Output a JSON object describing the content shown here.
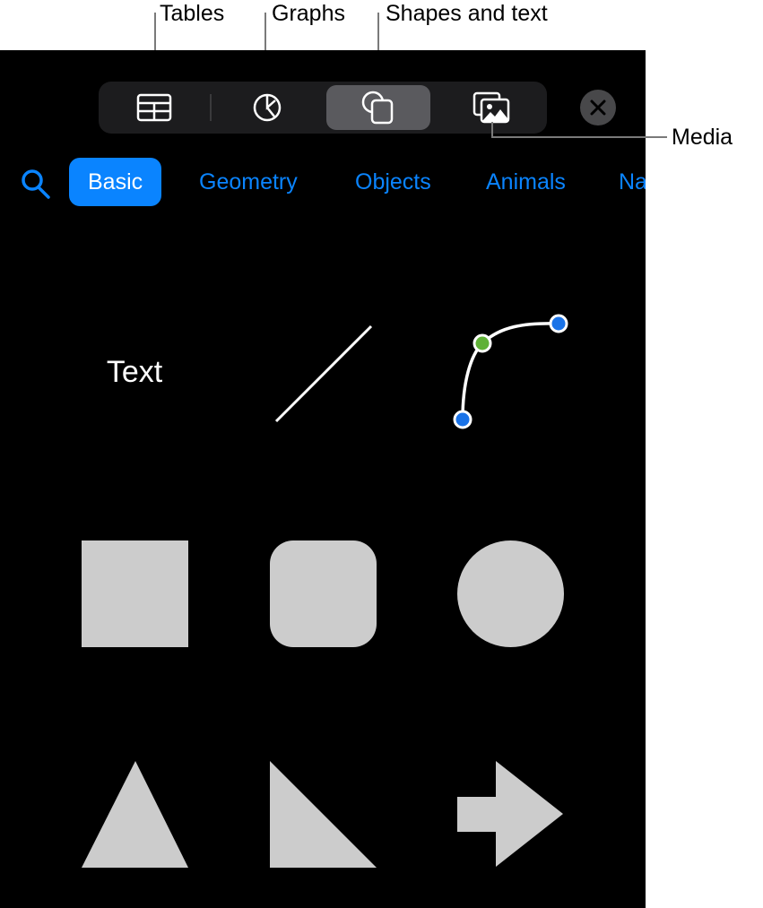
{
  "callouts": {
    "tables": "Tables",
    "graphs": "Graphs",
    "shapes_and_text": "Shapes and text",
    "media": "Media"
  },
  "toolbar": {
    "buttons": [
      {
        "name": "tables",
        "icon": "table-icon",
        "active": false
      },
      {
        "name": "graphs",
        "icon": "pie-chart-icon",
        "active": false
      },
      {
        "name": "shapes",
        "icon": "shapes-icon",
        "active": true
      },
      {
        "name": "media",
        "icon": "photo-icon",
        "active": false
      }
    ],
    "close_icon": "close-icon"
  },
  "categories": {
    "search_icon": "search-icon",
    "items": [
      "Basic",
      "Geometry",
      "Objects",
      "Animals",
      "Na"
    ],
    "selected": "Basic"
  },
  "shapes": {
    "text_label": "Text",
    "items": [
      "text",
      "line",
      "curve",
      "square",
      "rounded-square",
      "circle",
      "triangle",
      "right-triangle",
      "arrow"
    ]
  },
  "colors": {
    "accent": "#0a84ff",
    "shape_fill": "#cccccc",
    "curve_endpoint": "#1a73e8",
    "curve_midpoint": "#5fb136"
  }
}
